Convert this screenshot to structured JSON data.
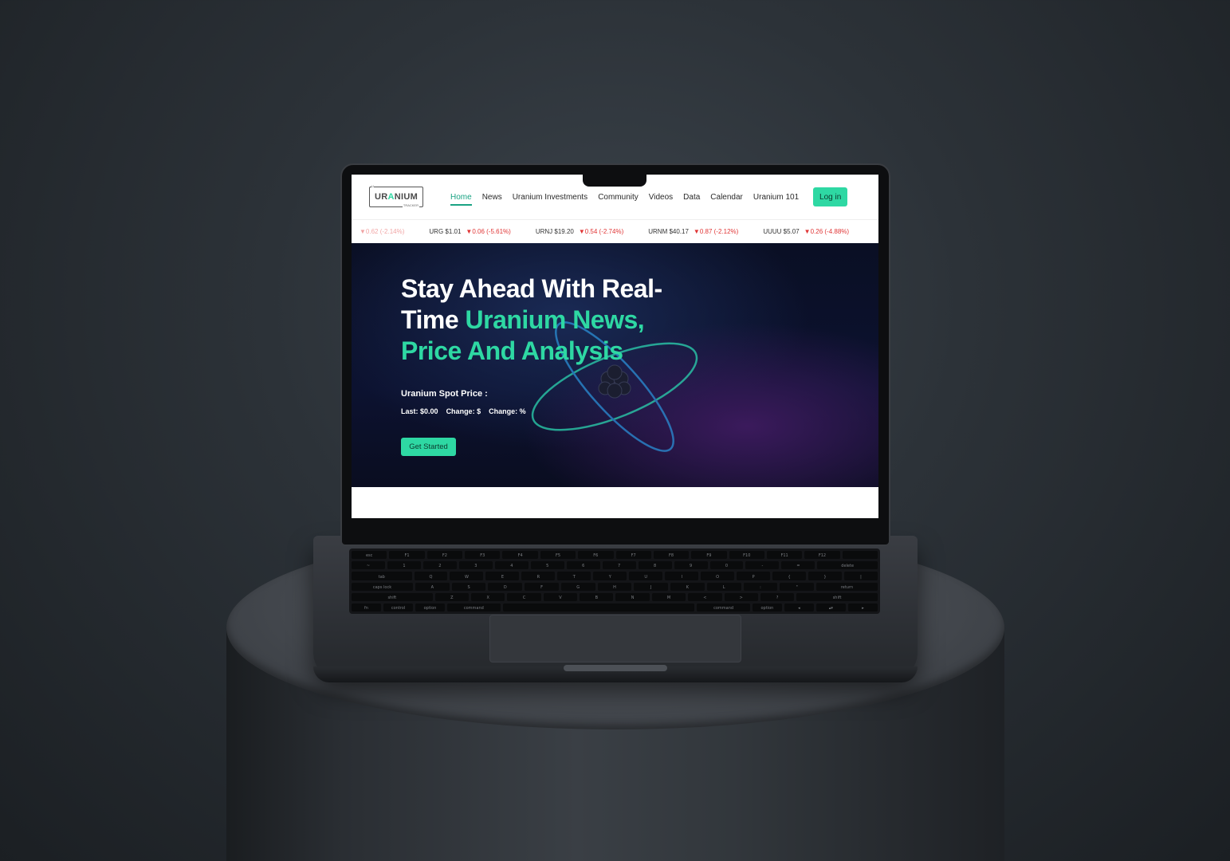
{
  "brand": {
    "logo_main_before": "UR",
    "logo_main_accent": "A",
    "logo_main_after": "NIUM",
    "logo_sub": "TRACKER",
    "logo_tiny": "U",
    "accent_color": "#2ed8a3"
  },
  "nav": {
    "items": [
      {
        "label": "Home",
        "active": true
      },
      {
        "label": "News"
      },
      {
        "label": "Uranium Investments"
      },
      {
        "label": "Community"
      },
      {
        "label": "Videos"
      },
      {
        "label": "Data"
      },
      {
        "label": "Calendar"
      },
      {
        "label": "Uranium 101"
      }
    ],
    "login_label": "Log in"
  },
  "ticker": [
    {
      "symbol": "",
      "change": "▼0.62 (-2.14%)"
    },
    {
      "symbol": "URG $1.01",
      "change": "▼0.06 (-5.61%)"
    },
    {
      "symbol": "URNJ $19.20",
      "change": "▼0.54 (-2.74%)"
    },
    {
      "symbol": "URNM $40.17",
      "change": "▼0.87 (-2.12%)"
    },
    {
      "symbol": "UUUU $5.07",
      "change": "▼0.26 (-4.88%)"
    }
  ],
  "hero": {
    "title_line1": "Stay Ahead With Real-",
    "title_line2_white": "Time ",
    "title_line2_green": "Uranium News,",
    "title_line3_green": "Price And Analysis",
    "spot_label": "Uranium Spot Price :",
    "last_label": "Last:",
    "last_value": "$0.00",
    "change1_label": "Change:",
    "change1_value": "$",
    "change2_label": "Change:",
    "change2_value": "%",
    "cta_label": "Get Started"
  },
  "keyboard": {
    "row1": [
      "esc",
      "F1",
      "F2",
      "F3",
      "F4",
      "F5",
      "F6",
      "F7",
      "F8",
      "F9",
      "F10",
      "F11",
      "F12",
      ""
    ],
    "row2": [
      "~",
      "1",
      "2",
      "3",
      "4",
      "5",
      "6",
      "7",
      "8",
      "9",
      "0",
      "-",
      "=",
      "delete"
    ],
    "row3": [
      "tab",
      "Q",
      "W",
      "E",
      "R",
      "T",
      "Y",
      "U",
      "I",
      "O",
      "P",
      "{",
      "}",
      "|"
    ],
    "row4": [
      "caps lock",
      "A",
      "S",
      "D",
      "F",
      "G",
      "H",
      "J",
      "K",
      "L",
      ":",
      "\"",
      "return"
    ],
    "row5": [
      "shift",
      "Z",
      "X",
      "C",
      "V",
      "B",
      "N",
      "M",
      "<",
      ">",
      "?",
      "shift"
    ],
    "row6": [
      "fn",
      "control",
      "option",
      "command",
      "",
      "command",
      "option",
      "◂",
      "▴▾",
      "▸"
    ]
  }
}
